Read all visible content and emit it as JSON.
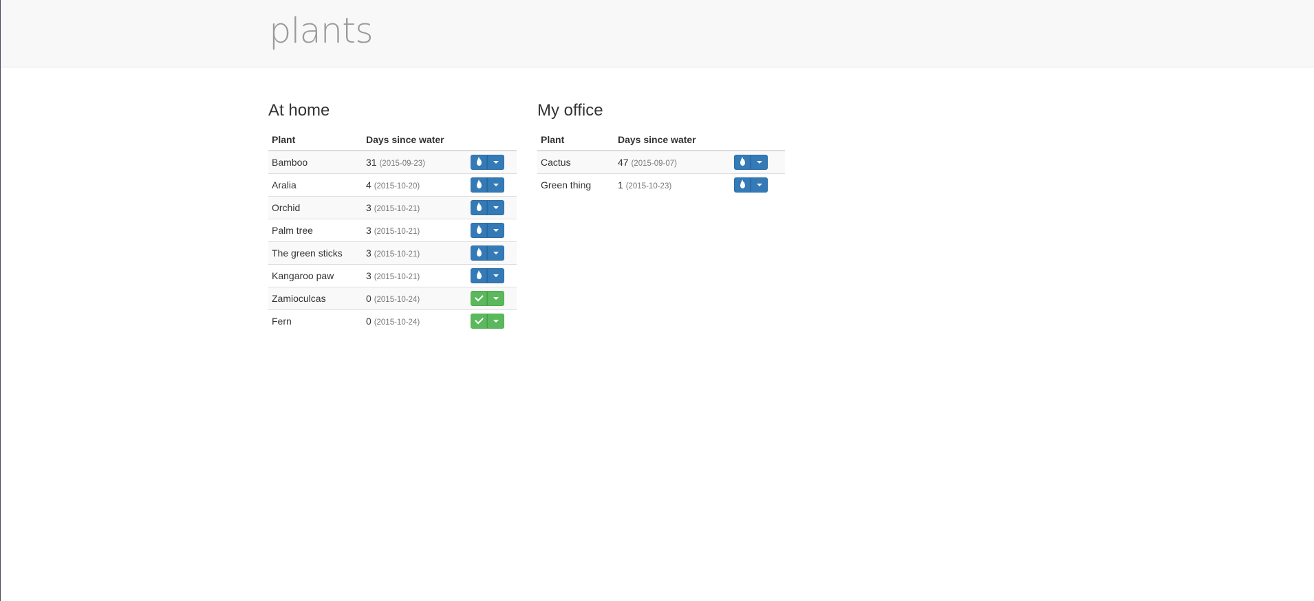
{
  "app": {
    "brand": "plants"
  },
  "colors": {
    "water_button": "#337ab7",
    "watered_button": "#5cb85c",
    "navbar_bg": "#f8f8f8"
  },
  "icons": {
    "water": "tint-icon",
    "watered": "check-icon",
    "dropdown": "caret-down-icon"
  },
  "home": {
    "title": "At home",
    "columns": {
      "plant": "Plant",
      "days": "Days since water"
    },
    "rows": [
      {
        "name": "Bamboo",
        "days": "31",
        "date": "(2015-09-23)",
        "status": "water"
      },
      {
        "name": "Aralia",
        "days": "4",
        "date": "(2015-10-20)",
        "status": "water"
      },
      {
        "name": "Orchid",
        "days": "3",
        "date": "(2015-10-21)",
        "status": "water"
      },
      {
        "name": "Palm tree",
        "days": "3",
        "date": "(2015-10-21)",
        "status": "water"
      },
      {
        "name": "The green sticks",
        "days": "3",
        "date": "(2015-10-21)",
        "status": "water"
      },
      {
        "name": "Kangaroo paw",
        "days": "3",
        "date": "(2015-10-21)",
        "status": "water"
      },
      {
        "name": "Zamioculcas",
        "days": "0",
        "date": "(2015-10-24)",
        "status": "watered"
      },
      {
        "name": "Fern",
        "days": "0",
        "date": "(2015-10-24)",
        "status": "watered"
      }
    ]
  },
  "office": {
    "title": "My office",
    "columns": {
      "plant": "Plant",
      "days": "Days since water"
    },
    "rows": [
      {
        "name": "Cactus",
        "days": "47",
        "date": "(2015-09-07)",
        "status": "water"
      },
      {
        "name": "Green thing",
        "days": "1",
        "date": "(2015-10-23)",
        "status": "water"
      }
    ]
  }
}
